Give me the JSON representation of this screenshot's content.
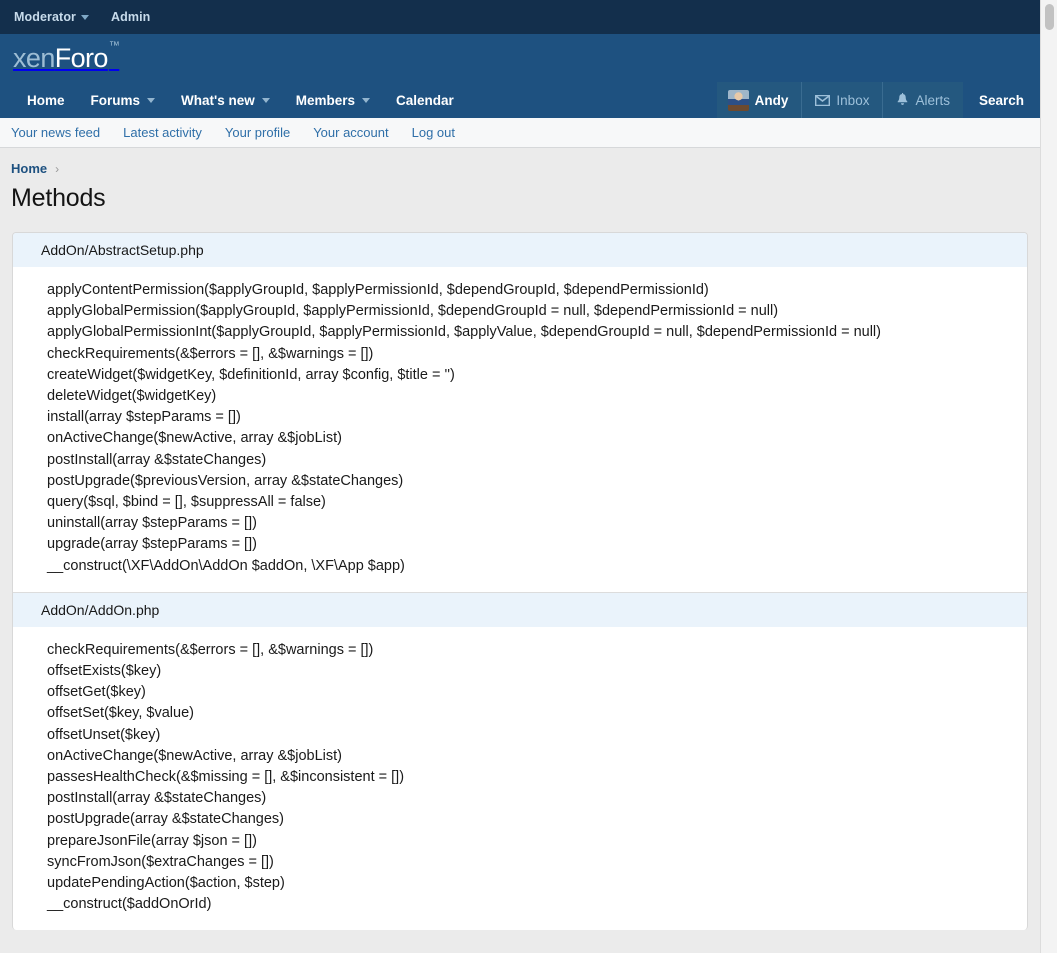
{
  "colors": {
    "topbar_bg": "#132f4c",
    "nav_bg": "#1e5180",
    "nav_visitor_bg": "#24587f",
    "page_bg": "#ebebeb",
    "card_bg": "#ffffff",
    "block_head_bg": "#eaf3fb",
    "link": "#2f6fa8",
    "crumb_link": "#1e5180"
  },
  "topbar": {
    "items": [
      {
        "label": "Moderator",
        "caret": true,
        "icon": "chevron-down-icon"
      },
      {
        "label": "Admin",
        "caret": false
      }
    ]
  },
  "brand": {
    "logo_part_one": "xen",
    "logo_part_two": "Foro",
    "trademark": "™"
  },
  "nav": {
    "items": [
      {
        "label": "Home",
        "caret": false
      },
      {
        "label": "Forums",
        "caret": true
      },
      {
        "label": "What's new",
        "caret": true
      },
      {
        "label": "Members",
        "caret": true
      },
      {
        "label": "Calendar",
        "caret": false
      }
    ],
    "visitor": {
      "username": "Andy",
      "avatar_icon": "avatar",
      "inbox_label": "Inbox",
      "inbox_icon": "envelope-icon",
      "alerts_label": "Alerts",
      "alerts_icon": "bell-icon"
    },
    "search_label": "Search",
    "search_icon": "search-icon"
  },
  "subnav": {
    "items": [
      {
        "label": "Your news feed"
      },
      {
        "label": "Latest activity"
      },
      {
        "label": "Your profile"
      },
      {
        "label": "Your account"
      },
      {
        "label": "Log out"
      }
    ]
  },
  "breadcrumb": {
    "items": [
      {
        "label": "Home"
      }
    ],
    "separator": "›"
  },
  "page": {
    "title": "Methods"
  },
  "blocks": [
    {
      "file": "AddOn/AbstractSetup.php",
      "methods": [
        "applyContentPermission($applyGroupId, $applyPermissionId, $dependGroupId, $dependPermissionId)",
        "applyGlobalPermission($applyGroupId, $applyPermissionId, $dependGroupId = null, $dependPermissionId = null)",
        "applyGlobalPermissionInt($applyGroupId, $applyPermissionId, $applyValue, $dependGroupId = null, $dependPermissionId = null)",
        "checkRequirements(&$errors = [], &$warnings = [])",
        "createWidget($widgetKey, $definitionId, array $config, $title = '')",
        "deleteWidget($widgetKey)",
        "install(array $stepParams = [])",
        "onActiveChange($newActive, array &$jobList)",
        "postInstall(array &$stateChanges)",
        "postUpgrade($previousVersion, array &$stateChanges)",
        "query($sql, $bind = [], $suppressAll = false)",
        "uninstall(array $stepParams = [])",
        "upgrade(array $stepParams = [])",
        "__construct(\\XF\\AddOn\\AddOn $addOn, \\XF\\App $app)"
      ]
    },
    {
      "file": "AddOn/AddOn.php",
      "methods": [
        "checkRequirements(&$errors = [], &$warnings = [])",
        "offsetExists($key)",
        "offsetGet($key)",
        "offsetSet($key, $value)",
        "offsetUnset($key)",
        "onActiveChange($newActive, array &$jobList)",
        "passesHealthCheck(&$missing = [], &$inconsistent = [])",
        "postInstall(array &$stateChanges)",
        "postUpgrade(array &$stateChanges)",
        "prepareJsonFile(array $json = [])",
        "syncFromJson($extraChanges = [])",
        "updatePendingAction($action, $step)",
        "__construct($addOnOrId)"
      ]
    }
  ],
  "scrollbar": {
    "thumb_position": "top"
  }
}
